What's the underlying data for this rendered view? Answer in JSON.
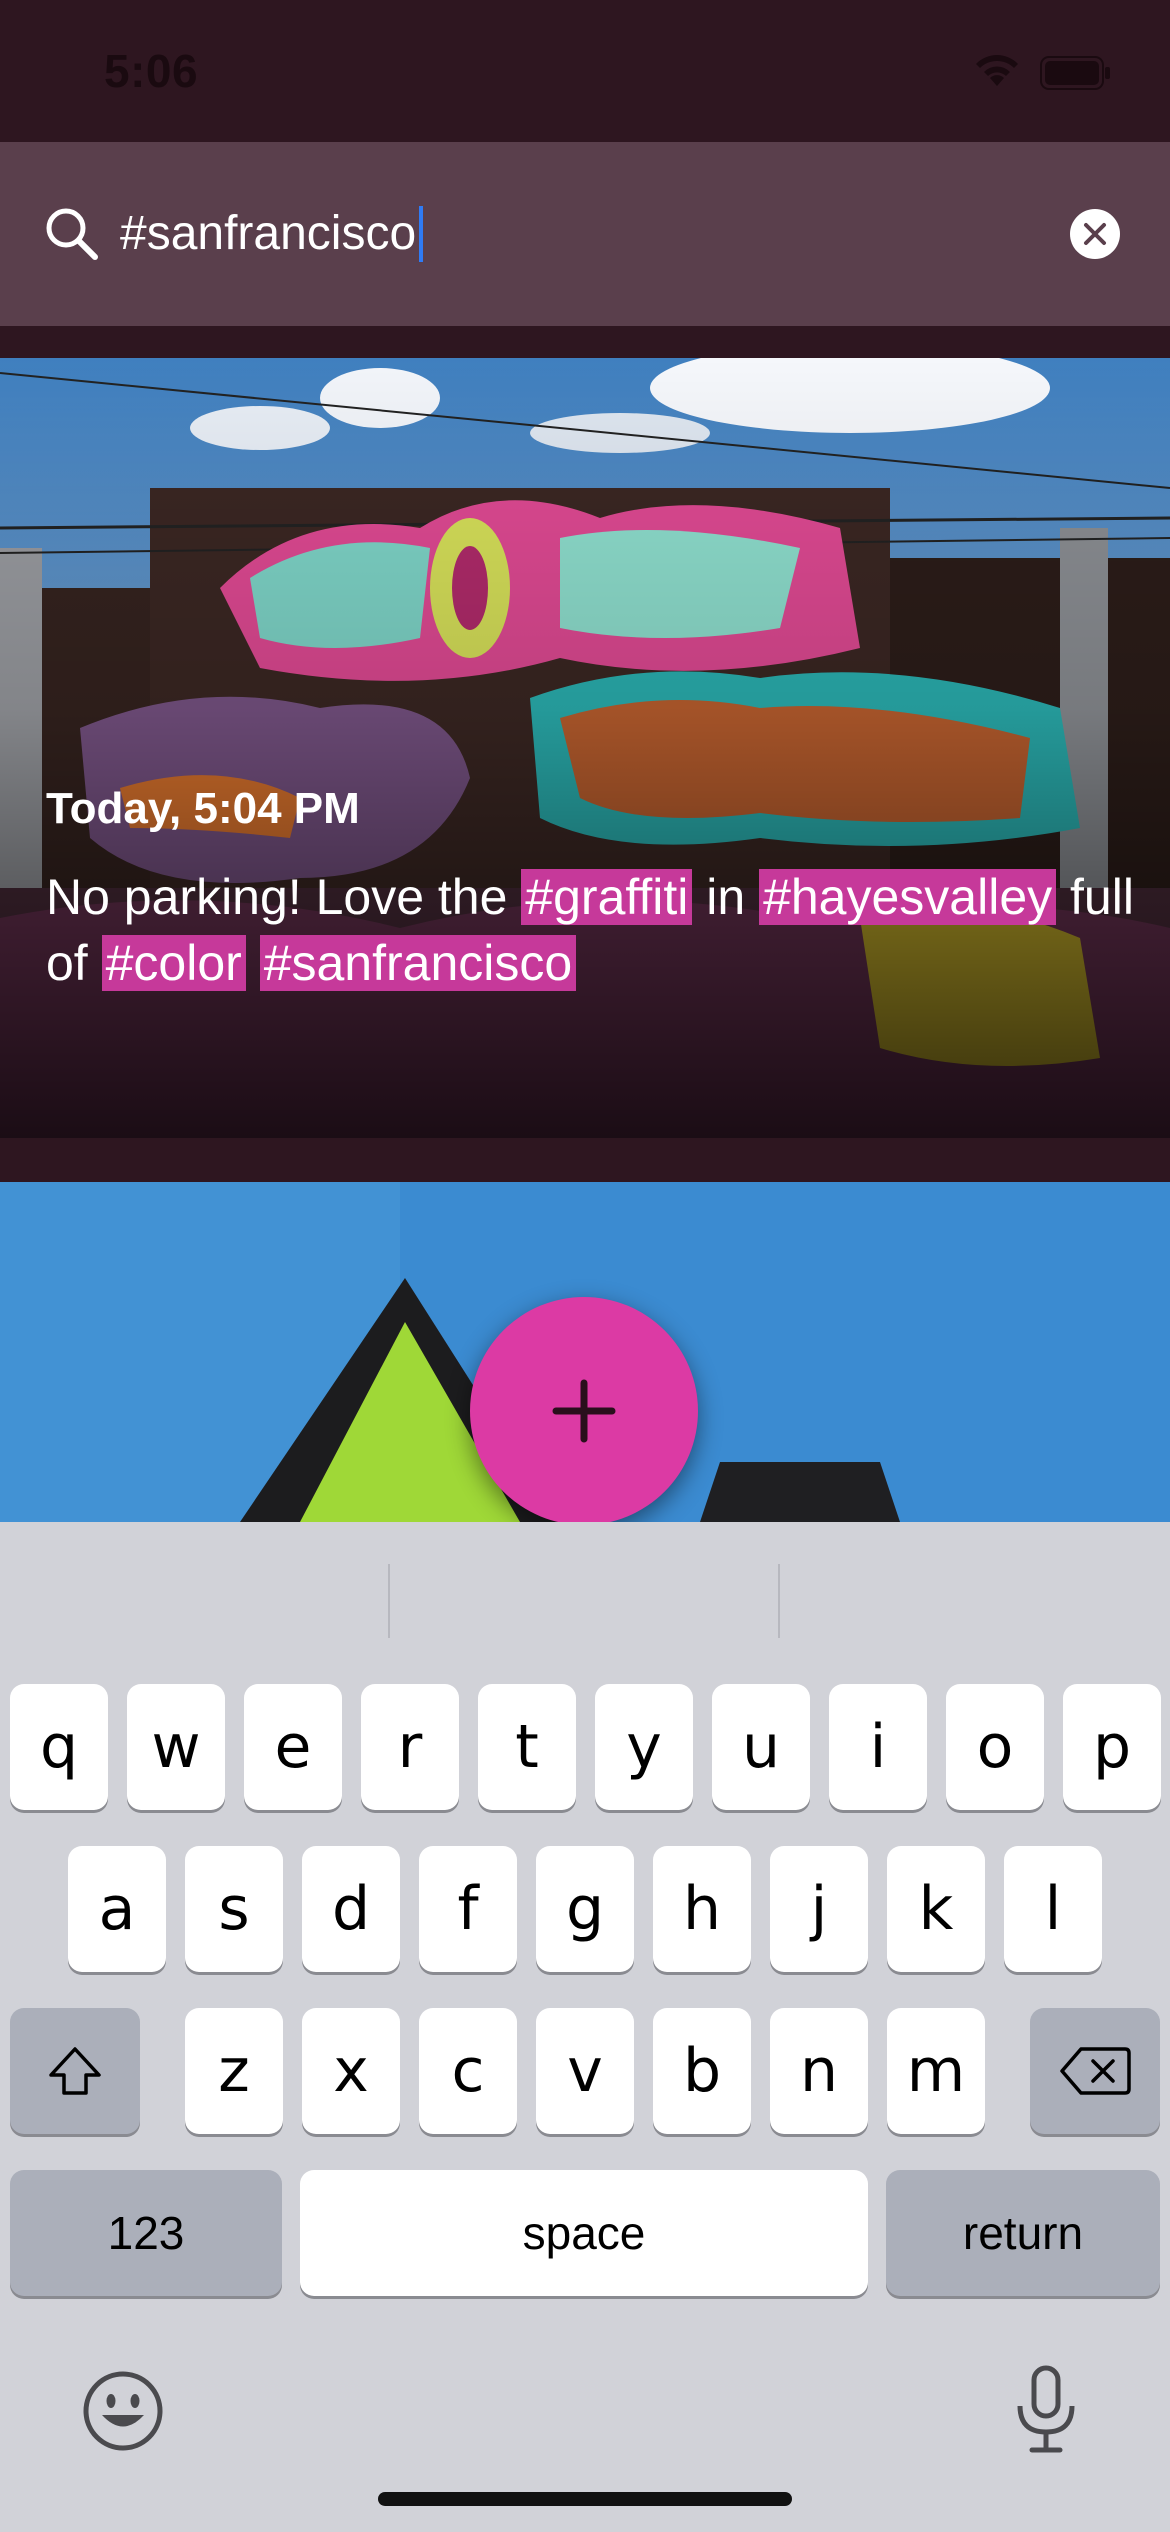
{
  "status_bar": {
    "time": "5:06"
  },
  "search": {
    "query": "#sanfrancisco"
  },
  "post": {
    "timestamp": "Today, 5:04 PM",
    "caption_parts": [
      {
        "text": "No parking! Love the ",
        "tag": false
      },
      {
        "text": "#graffiti",
        "tag": true
      },
      {
        "text": " in ",
        "tag": false
      },
      {
        "text": "#hayesvalley",
        "tag": true
      },
      {
        "text": " full of ",
        "tag": false
      },
      {
        "text": "#color",
        "tag": true
      },
      {
        "text": " ",
        "tag": false
      },
      {
        "text": "#sanfrancisco",
        "tag": true
      }
    ]
  },
  "fab": {
    "icon": "plus-icon"
  },
  "keyboard": {
    "row1": [
      "q",
      "w",
      "e",
      "r",
      "t",
      "y",
      "u",
      "i",
      "o",
      "p"
    ],
    "row2": [
      "a",
      "s",
      "d",
      "f",
      "g",
      "h",
      "j",
      "k",
      "l"
    ],
    "row3": [
      "z",
      "x",
      "c",
      "v",
      "b",
      "n",
      "m"
    ],
    "numbers_label": "123",
    "space_label": "space",
    "return_label": "return"
  },
  "colors": {
    "accent": "#dc3aa4",
    "tag_highlight": "#c6399a",
    "background": "#2e1620",
    "search_bar": "#5a3f4c"
  }
}
